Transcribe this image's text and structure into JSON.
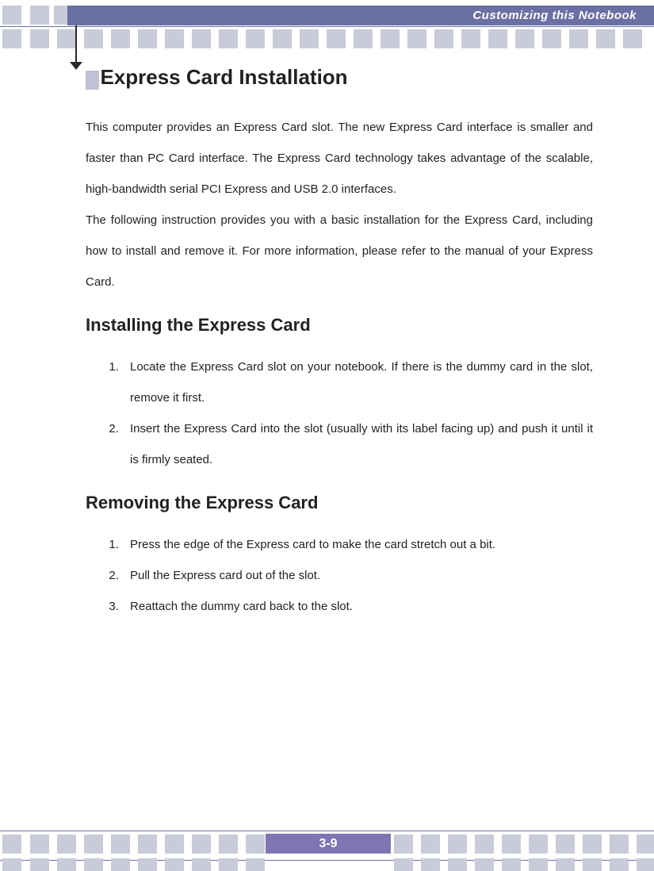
{
  "header": {
    "title": "Customizing this Notebook"
  },
  "main_heading": "Express Card Installation",
  "intro_p1": "This computer provides an Express Card slot.   The new Express Card interface is smaller and faster than PC Card interface.   The Express Card technology takes advantage of the scalable, high-bandwidth serial PCI Express and USB 2.0 interfaces.",
  "intro_p2": "The following instruction provides you with a basic installation for the Express Card, including how to install and remove it.   For more information, please refer to the manual of your Express Card.",
  "section_install": {
    "heading": "Installing the Express Card",
    "items": [
      "Locate the Express Card slot on your notebook.   If there is the dummy card in the slot, remove it first.",
      "Insert the Express Card into the slot (usually with its label facing up) and push it until it is firmly seated."
    ]
  },
  "section_remove": {
    "heading": "Removing the Express Card",
    "items": [
      "Press the edge of the Express card to make the card stretch out a bit.",
      "Pull the Express card out of the slot.",
      "Reattach the dummy card back to the slot."
    ]
  },
  "footer": {
    "page": "3-9"
  }
}
